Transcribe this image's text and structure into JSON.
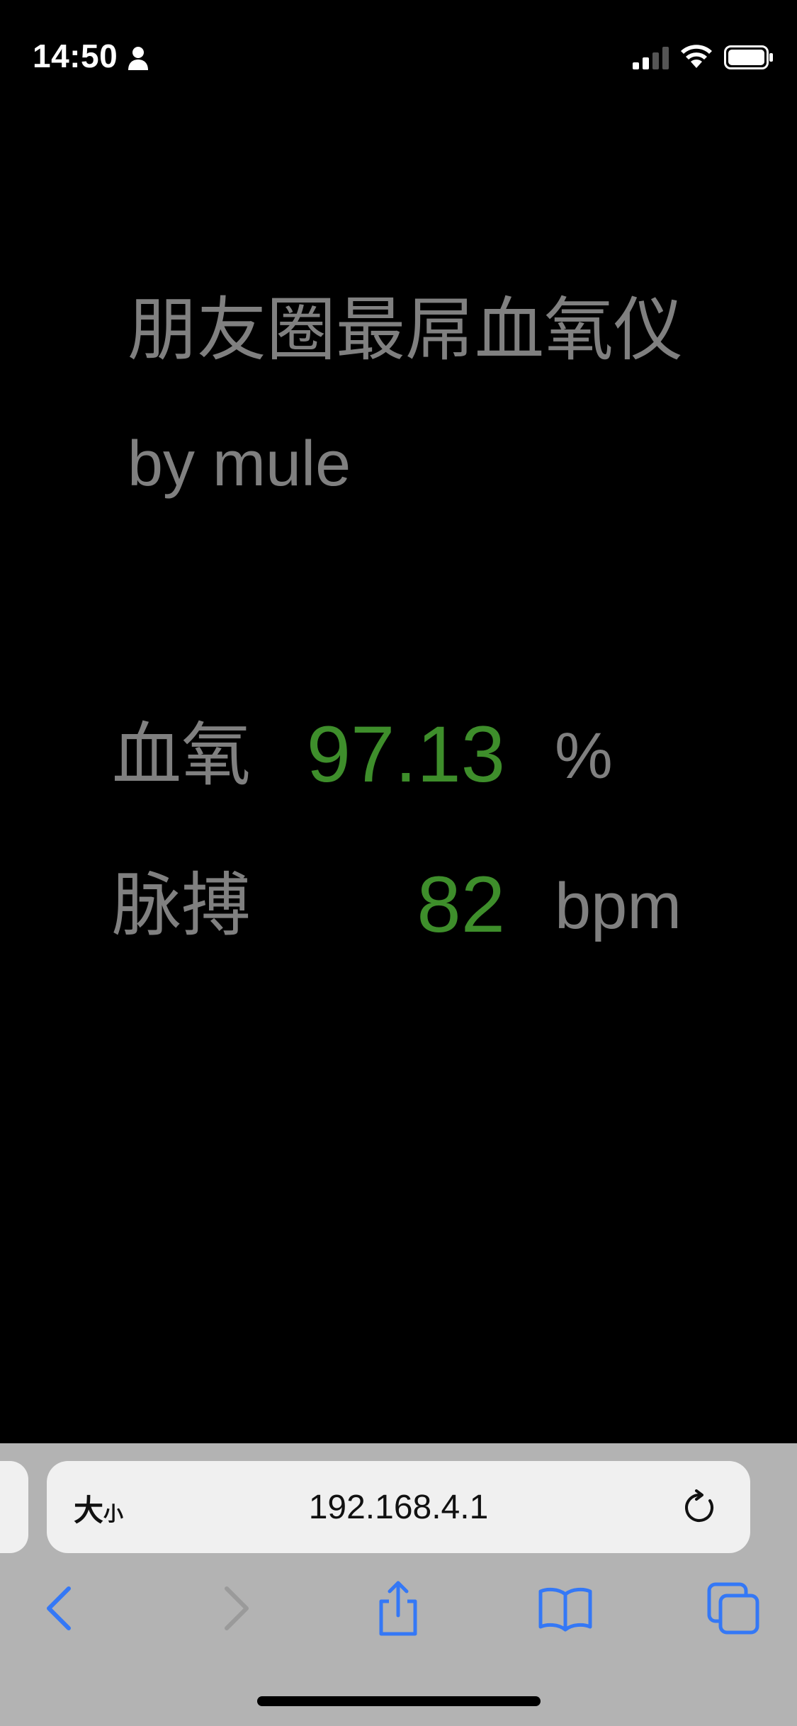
{
  "status_bar": {
    "time": "14:50"
  },
  "content": {
    "title": "朋友圈最屌血氧仪",
    "subtitle": "by mule",
    "metrics": [
      {
        "label": "血氧",
        "value": "97.13",
        "unit": "%"
      },
      {
        "label": "脉搏",
        "value": "82",
        "unit": "bpm"
      }
    ]
  },
  "browser": {
    "text_size_big": "大",
    "text_size_small": "小",
    "url": "192.168.4.1",
    "toolbar_icons": [
      "back-icon",
      "forward-icon",
      "share-icon",
      "bookmarks-icon",
      "tabs-icon"
    ]
  },
  "colors": {
    "background": "#000000",
    "text_gray": "#808080",
    "value_green": "#3e8e2b",
    "toolbar_bg": "#b3b3b3",
    "ios_blue": "#3478f6"
  }
}
